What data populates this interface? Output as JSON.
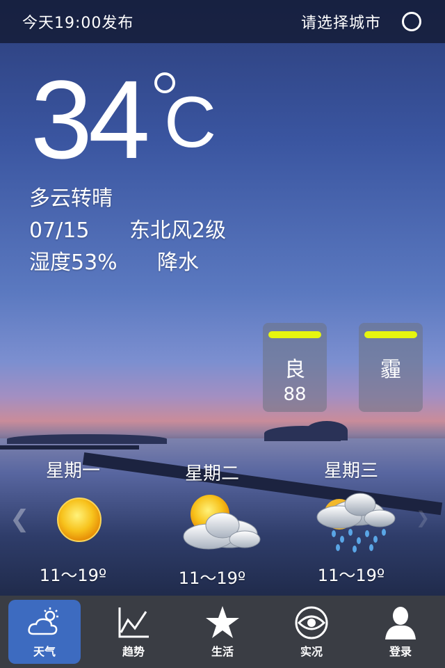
{
  "header": {
    "publish_time": "今天19:00发布",
    "city_select": "请选择城市"
  },
  "current": {
    "temperature": "34",
    "unit": "C",
    "condition": "多云转晴",
    "date": "07/15",
    "wind": "东北风2级",
    "humidity": "湿度53%",
    "precipitation": "降水"
  },
  "aqi_cards": [
    {
      "level": "良",
      "value": "88",
      "bar_color": "#e6f50f"
    },
    {
      "level": "霾",
      "value": "",
      "bar_color": "#e6f50f"
    }
  ],
  "forecast": [
    {
      "day": "星期一",
      "icon": "sunny-icon",
      "range": "11～19º"
    },
    {
      "day": "星期二",
      "icon": "partly-cloudy-icon",
      "range": "11～19º"
    },
    {
      "day": "星期三",
      "icon": "rain-icon",
      "range": "11～19º"
    }
  ],
  "nav": [
    {
      "label": "天气",
      "icon": "weather-icon",
      "active": true
    },
    {
      "label": "趋势",
      "icon": "trend-icon",
      "active": false
    },
    {
      "label": "生活",
      "icon": "star-icon",
      "active": false
    },
    {
      "label": "实况",
      "icon": "eye-icon",
      "active": false
    },
    {
      "label": "登录",
      "icon": "user-icon",
      "active": false
    }
  ],
  "colors": {
    "nav_active": "#3d6bc0",
    "nav_bg": "#3a3d44",
    "aqi_bar": "#e6f50f"
  }
}
